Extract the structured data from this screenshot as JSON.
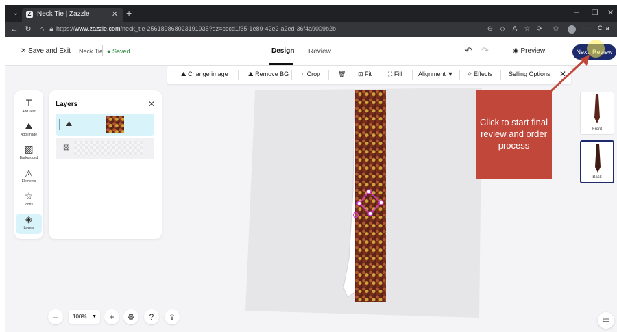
{
  "browser": {
    "tab_title": "Neck Tie | Zazzle",
    "tab_favicon": "Z",
    "url_prefix": "https://",
    "url_host": "www.zazzle.com",
    "url_path": "/neck_tie-256189868023191935?dz=cccd1f35-1e89-42e2-a2ed-36f4a9009b2b",
    "copilot_label": "Cha"
  },
  "header": {
    "save_exit": "Save and Exit",
    "product_name": "Neck Tie",
    "saved_status": "Saved",
    "tabs": [
      {
        "label": "Design"
      },
      {
        "label": "Review"
      }
    ],
    "preview_label": "Preview",
    "next_label": "Next: Review"
  },
  "toolbar": {
    "items": [
      {
        "label": "Change image"
      },
      {
        "label": "Remove BG"
      },
      {
        "label": "Crop"
      },
      {
        "label": "Fit"
      },
      {
        "label": "Fill"
      },
      {
        "label": "Alignment"
      },
      {
        "label": "Effects"
      },
      {
        "label": "Selling Options"
      }
    ]
  },
  "rail": {
    "items": [
      {
        "label": "Add Text"
      },
      {
        "label": "Add Image"
      },
      {
        "label": "Background"
      },
      {
        "label": "Elements"
      },
      {
        "label": "Icons"
      },
      {
        "label": "Layers"
      }
    ]
  },
  "layers_panel": {
    "title": "Layers"
  },
  "callout": {
    "text": "Click to start final review and order process",
    "color": "#c0473a"
  },
  "views": [
    {
      "label": "Front"
    },
    {
      "label": "Back"
    }
  ],
  "zoom": {
    "value": "100%"
  },
  "colors": {
    "brand_navy": "#1d2a6b",
    "selection_blue": "#d9f3fb",
    "saved_green": "#2b8a3e"
  }
}
